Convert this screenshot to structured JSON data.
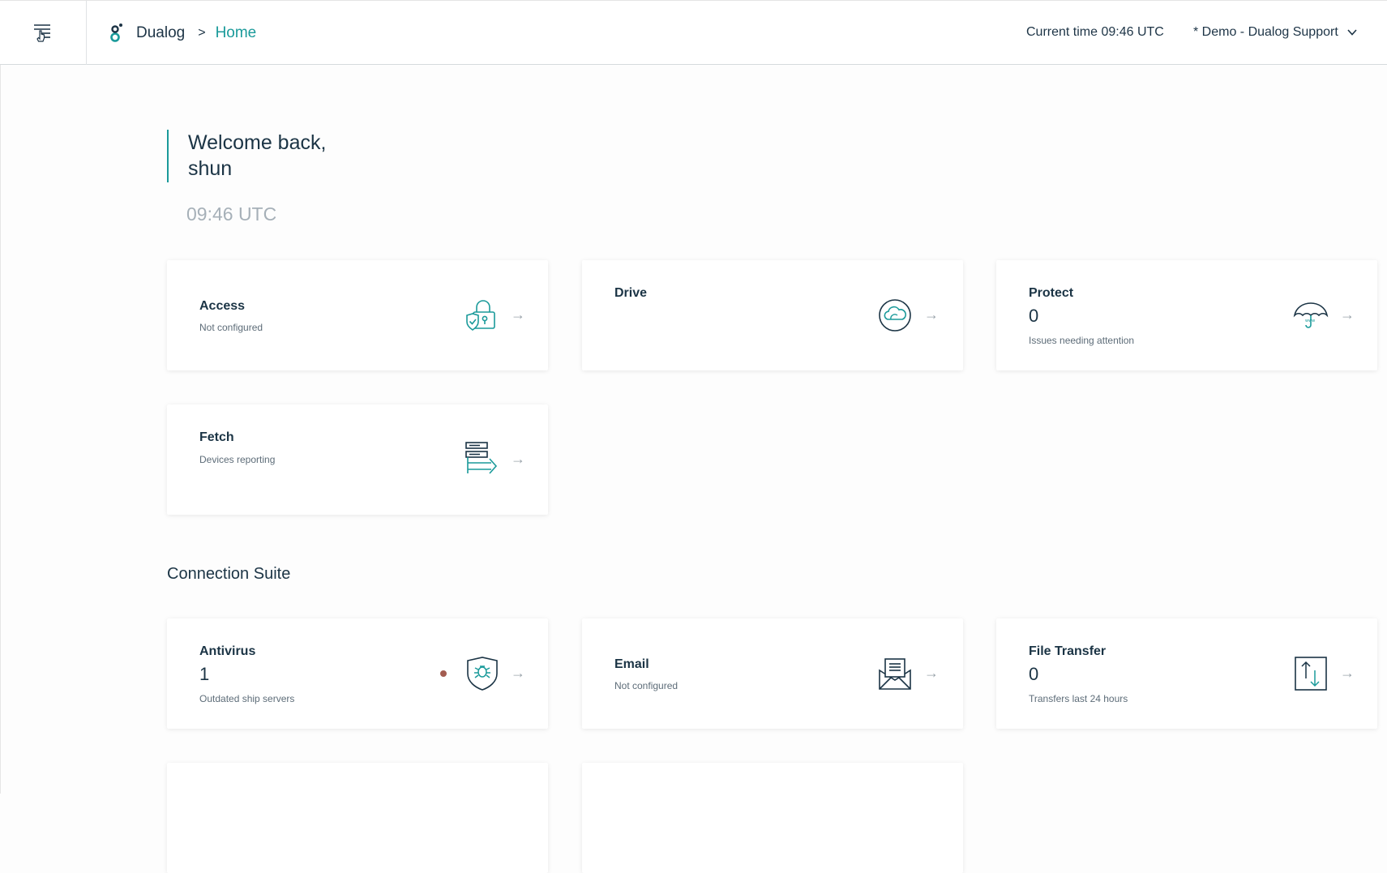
{
  "header": {
    "brand": "Dualog",
    "separator": ">",
    "breadcrumb_current": "Home",
    "current_time": "Current time 09:46 UTC",
    "account": "* Demo - Dualog Support"
  },
  "welcome": {
    "line1": "Welcome back,",
    "line2": "shun",
    "time": "09:46 UTC"
  },
  "arrow_glyph": "→",
  "cards": {
    "access": {
      "title": "Access",
      "sub": "Not configured",
      "icon": "lock-shield-icon"
    },
    "drive": {
      "title": "Drive",
      "icon": "cloud-icon"
    },
    "protect": {
      "title": "Protect",
      "num": "0",
      "sub": "Issues needing attention",
      "icon": "umbrella-icon"
    },
    "fetch": {
      "title": "Fetch",
      "sub": "Devices reporting",
      "icon": "server-transfer-icon"
    },
    "antivirus": {
      "title": "Antivirus",
      "num": "1",
      "sub": "Outdated ship servers",
      "icon": "shield-bug-icon",
      "status_color": "#a35c50"
    },
    "email": {
      "title": "Email",
      "sub": "Not configured",
      "icon": "envelope-icon"
    },
    "filetransfer": {
      "title": "File Transfer",
      "num": "0",
      "sub": "Transfers last 24 hours",
      "icon": "upload-download-icon"
    }
  },
  "section": {
    "connection_suite": "Connection Suite"
  },
  "colors": {
    "accent": "#1a9a9a",
    "text": "#1b3445",
    "muted": "#a6b0b8"
  }
}
